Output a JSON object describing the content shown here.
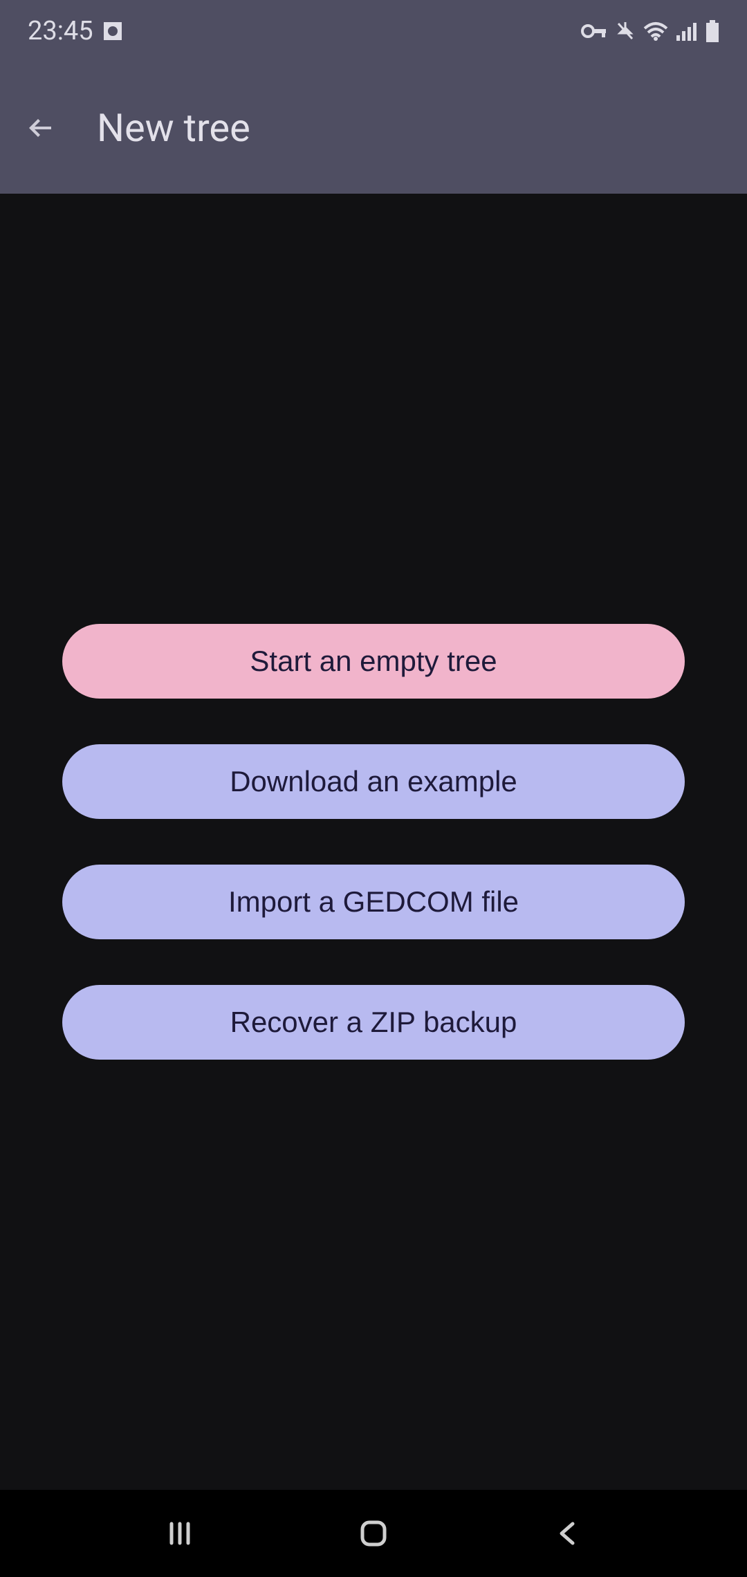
{
  "statusbar": {
    "time": "23:45"
  },
  "appbar": {
    "title": "New tree"
  },
  "options": {
    "start_empty": "Start an empty tree",
    "download_example": "Download an example",
    "import_gedcom": "Import a GEDCOM file",
    "recover_zip": "Recover a ZIP backup"
  }
}
